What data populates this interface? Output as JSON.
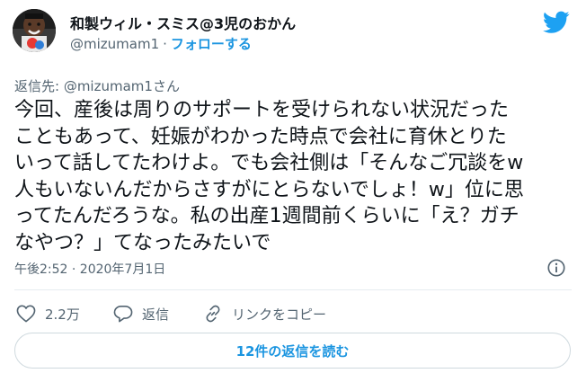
{
  "author": {
    "display_name": "和製ウィル・スミス@3児のおかん",
    "handle": "@mizumam1",
    "separator": "·",
    "follow_label": "フォローする"
  },
  "reply_to": "返信先: @mizumam1さん",
  "tweet": {
    "lines": [
      "今回、産後は周りのサポートを受けられない状況だった",
      "こともあって、妊娠がわかった時点で会社に育休とりた",
      "いって話してたわけよ。でも会社側は「そんなご冗談をw",
      "人もいないんだからさすがにとらないでしょ！w」位に思",
      "ってたんだろうな。私の出産1週間前くらいに「え？ガチ",
      "なやつ？」てなったみたいで"
    ]
  },
  "timestamp": "午後2:52 · 2020年7月1日",
  "actions": {
    "like_count": "2.2万",
    "reply_label": "返信",
    "copy_link_label": "リンクをコピー"
  },
  "read_replies_label": "12件の返信を読む",
  "colors": {
    "accent": "#1b95e0",
    "twitter_blue": "#1da1f2",
    "secondary_text": "#536471",
    "border": "#cfd9de"
  },
  "icons": {
    "avatar": "avatar",
    "logo": "twitter-bird-icon",
    "info": "info-icon",
    "like": "heart-icon",
    "reply": "speech-bubble-icon",
    "copy_link": "link-icon"
  }
}
